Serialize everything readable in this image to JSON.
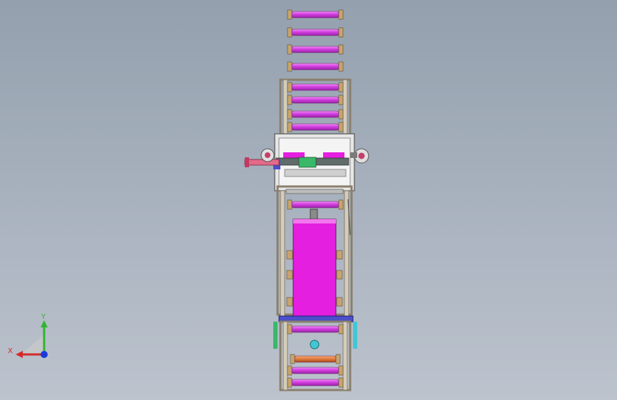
{
  "viewport": {
    "background_top": "#94a0ae",
    "background_bottom": "#bcc3cd"
  },
  "colors": {
    "roller": "#d33fe0",
    "roller_highlight": "#f28cf7",
    "roller_dark": "#9a22a8",
    "roller_end": "#c7a46f",
    "frame": "#8a7f6c",
    "frame_light": "#d4cdbb",
    "panel": "#e6e6e6",
    "magenta_block": "#e51fe0",
    "blue_bar": "#4b4fc9",
    "orange_roller": "#e07a3c",
    "cyan_part": "#3fc8d4",
    "green_part": "#39b86a"
  },
  "triad": {
    "x_label": "X",
    "y_label": "Y",
    "x_color": "#d42a2a",
    "y_color": "#2fb52f",
    "z_color": "#1c3ad9"
  }
}
